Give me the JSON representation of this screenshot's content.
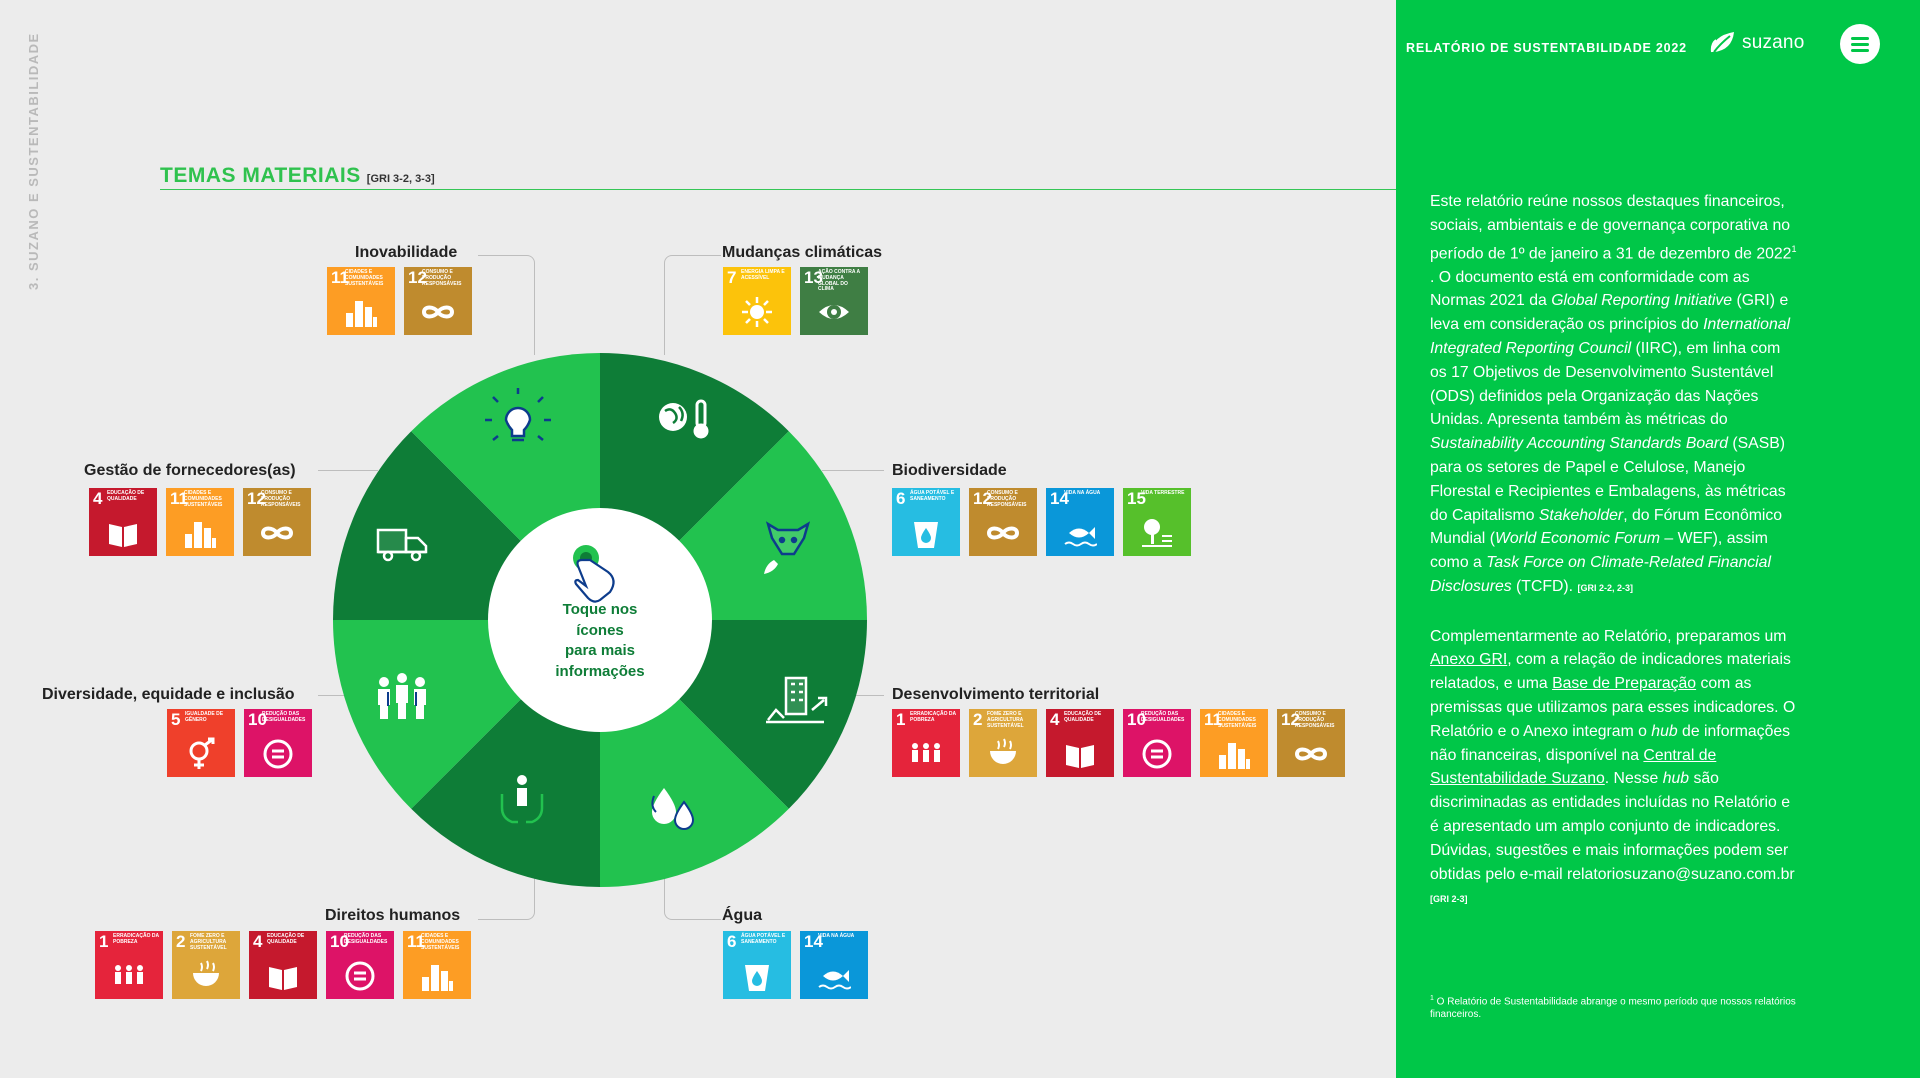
{
  "side_label": "3. SUZANO E SUSTENTABILIDADE",
  "section": {
    "title": "TEMAS MATERIAIS",
    "gri": "[GRI 3-2, 3-3]"
  },
  "wheel": {
    "center_text": [
      "Toque nos",
      "ícones",
      "para mais",
      "informações"
    ]
  },
  "themes": {
    "inovabilidade": "Inovabilidade",
    "mudancas": "Mudanças climáticas",
    "fornecedores": "Gestão de fornecedores(as)",
    "biodiversidade": "Biodiversidade",
    "diversidade": "Diversidade, equidade e inclusão",
    "territorial": "Desenvolvimento territorial",
    "direitos": "Direitos humanos",
    "agua": "Água"
  },
  "ods": {
    "1": {
      "num": "1",
      "label": "ERRADICAÇÃO DA POBREZA",
      "color": "#e5243b"
    },
    "2": {
      "num": "2",
      "label": "FOME ZERO E AGRICULTURA SUSTENTÁVEL",
      "color": "#dda63a"
    },
    "4": {
      "num": "4",
      "label": "EDUCAÇÃO DE QUALIDADE",
      "color": "#c5192d"
    },
    "5": {
      "num": "5",
      "label": "IGUALDADE DE GÊNERO",
      "color": "#ef402b"
    },
    "6": {
      "num": "6",
      "label": "ÁGUA POTÁVEL E SANEAMENTO",
      "color": "#26bde2"
    },
    "7": {
      "num": "7",
      "label": "ENERGIA LIMPA E ACESSÍVEL",
      "color": "#fcc30b"
    },
    "10": {
      "num": "10",
      "label": "REDUÇÃO DAS DESIGUALDADES",
      "color": "#dd1367"
    },
    "11": {
      "num": "11",
      "label": "CIDADES E COMUNIDADES SUSTENTÁVEIS",
      "color": "#fd9d24"
    },
    "12": {
      "num": "12",
      "label": "CONSUMO E PRODUÇÃO RESPONSÁVEIS",
      "color": "#bf8b2e"
    },
    "13": {
      "num": "13",
      "label": "AÇÃO CONTRA A MUDANÇA GLOBAL DO CLIMA",
      "color": "#3f7e44"
    },
    "14": {
      "num": "14",
      "label": "VIDA NA ÁGUA",
      "color": "#0a97d9"
    },
    "15": {
      "num": "15",
      "label": "VIDA TERRESTRE",
      "color": "#56c02b"
    }
  },
  "panel": {
    "header": "RELATÓRIO DE SUSTENTABILIDADE 2022",
    "logo": "suzano",
    "p1": {
      "a": "Este relatório reúne nossos destaques financeiros, sociais, ambientais e de governança corporativa no período de 1º de janeiro a 31 de dezembro de 2022",
      "sup": "1",
      "b": " . O documento está em conformidade com as Normas 2021 da ",
      "gri_name": "Global Reporting Initiative",
      "c": " (GRI) e leva em consideração os princípios do ",
      "iirc_name": "International Integrated Reporting Council",
      "d": " (IIRC), em linha com os 17 Objetivos de Desenvolvimento Sustentável (ODS) definidos pela Organização das Nações Unidas. Apresenta também às métricas do ",
      "sasb_name": "Sustainability Accounting Standards Board",
      "e": " (SASB) para os setores de Papel e Celulose, Manejo Florestal e Recipientes e Embalagens, às métricas do Capitalismo ",
      "stakeholder": "Stakeholder",
      "f": ", do Fórum Econômico Mundial (",
      "wef": "World Economic Forum",
      "g": " – WEF), assim como a ",
      "tcfd": "Task Force on Climate-Related Financial Disclosures",
      "h": " (TCFD). ",
      "gri": "[GRI 2-2, 2-3]"
    },
    "p2": {
      "a": "Complementarmente ao Relatório, preparamos um ",
      "link1": "Anexo GRI",
      "b": ", com a relação de indicadores materiais relatados, e uma ",
      "link2": "Base de Preparação",
      "c": " com as premissas que utilizamos para esses indicadores. O Relatório e o Anexo integram o ",
      "hub1": "hub",
      "d": " de informações não financeiras, disponível na ",
      "link3": "Central de Sustentabilidade Suzano",
      "e": ". Nesse ",
      "hub2": "hub",
      "f": " são discriminadas as entidades incluídas no Relatório e é apresentado um amplo conjunto de indicadores. Dúvidas, sugestões e mais informações podem ser obtidas pelo e-mail relatoriosuzano@suzano.com.br ",
      "gri": "[GRI 2-3]"
    },
    "footnote": {
      "sup": "1",
      "text": " O Relatório de Sustentabilidade abrange o mesmo período que nossos relatórios financeiros."
    }
  }
}
